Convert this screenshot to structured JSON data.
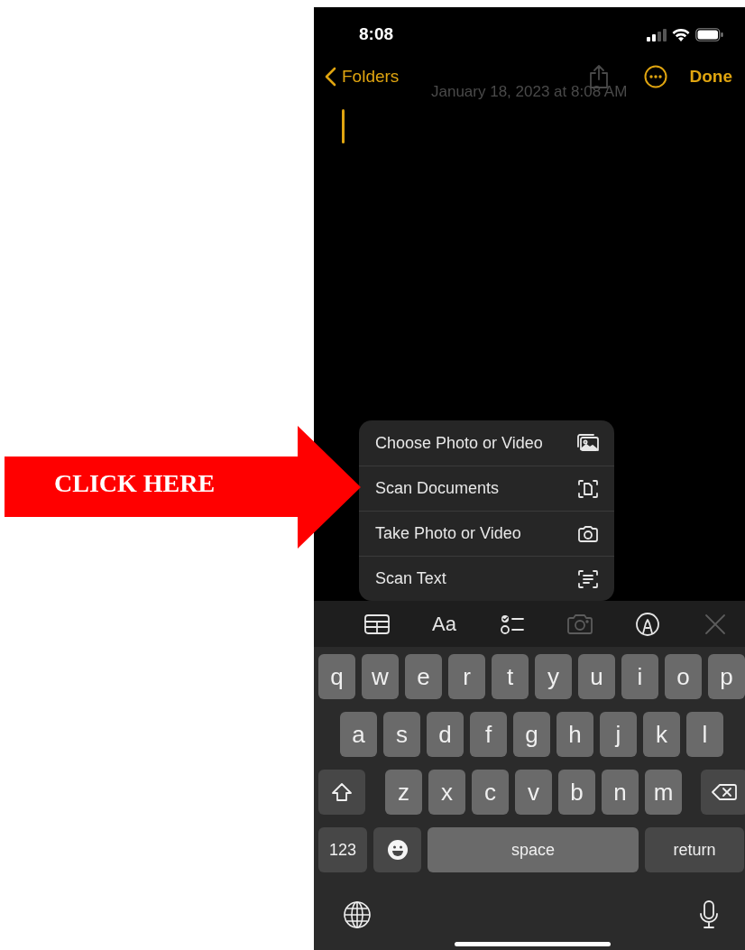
{
  "annotation": {
    "label": "CLICK HERE"
  },
  "status_bar": {
    "time": "8:08"
  },
  "nav": {
    "back": "Folders",
    "done": "Done"
  },
  "note": {
    "date": "January 18, 2023 at 8:08 AM"
  },
  "attach_menu": {
    "items": [
      {
        "label": "Choose Photo or Video",
        "kind": "photos"
      },
      {
        "label": "Scan Documents",
        "kind": "scan-document"
      },
      {
        "label": "Take Photo or Video",
        "kind": "camera"
      },
      {
        "label": "Scan Text",
        "kind": "scan-text"
      }
    ]
  },
  "toolbar": {
    "items": [
      {
        "kind": "table",
        "disabled": false
      },
      {
        "kind": "format",
        "label": "Aa",
        "disabled": false
      },
      {
        "kind": "checklist",
        "disabled": false
      },
      {
        "kind": "camera",
        "disabled": true
      },
      {
        "kind": "markup",
        "disabled": false
      },
      {
        "kind": "close",
        "disabled": true
      }
    ]
  },
  "keyboard": {
    "rows": [
      {
        "keys": [
          {
            "kind": "letter",
            "label": "q"
          },
          {
            "kind": "letter",
            "label": "w"
          },
          {
            "kind": "letter",
            "label": "e"
          },
          {
            "kind": "letter",
            "label": "r"
          },
          {
            "kind": "letter",
            "label": "t"
          },
          {
            "kind": "letter",
            "label": "y"
          },
          {
            "kind": "letter",
            "label": "u"
          },
          {
            "kind": "letter",
            "label": "i"
          },
          {
            "kind": "letter",
            "label": "o"
          },
          {
            "kind": "letter",
            "label": "p"
          }
        ]
      },
      {
        "keys": [
          {
            "kind": "letter",
            "label": "a"
          },
          {
            "kind": "letter",
            "label": "s"
          },
          {
            "kind": "letter",
            "label": "d"
          },
          {
            "kind": "letter",
            "label": "f"
          },
          {
            "kind": "letter",
            "label": "g"
          },
          {
            "kind": "letter",
            "label": "h"
          },
          {
            "kind": "letter",
            "label": "j"
          },
          {
            "kind": "letter",
            "label": "k"
          },
          {
            "kind": "letter",
            "label": "l"
          }
        ]
      },
      {
        "keys": [
          {
            "kind": "shift"
          },
          {
            "kind": "letter",
            "label": "z"
          },
          {
            "kind": "letter",
            "label": "x"
          },
          {
            "kind": "letter",
            "label": "c"
          },
          {
            "kind": "letter",
            "label": "v"
          },
          {
            "kind": "letter",
            "label": "b"
          },
          {
            "kind": "letter",
            "label": "n"
          },
          {
            "kind": "letter",
            "label": "m"
          },
          {
            "kind": "delete"
          }
        ]
      },
      {
        "keys": [
          {
            "kind": "numbers",
            "label": "123"
          },
          {
            "kind": "emoji"
          },
          {
            "kind": "space",
            "label": "space"
          },
          {
            "kind": "return",
            "label": "return"
          }
        ]
      }
    ]
  }
}
